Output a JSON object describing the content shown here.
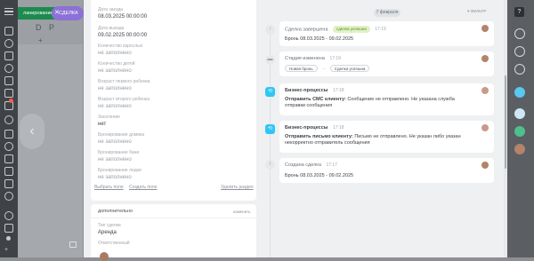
{
  "background_app": {
    "green_bar_label": "ланирование (1",
    "deal_chip_label": "СДЕЛКА",
    "close_glyph": "✕",
    "list_header": "D P",
    "plus_glyph": "+",
    "arrow_glyph": "‹"
  },
  "details": {
    "fields": [
      {
        "label": "Дата заезда",
        "value": "08.03.2025 00:00:00"
      },
      {
        "label": "Дата выезда",
        "value": "09.02.2025 00:00:00"
      },
      {
        "label": "Количество взрослых",
        "value": "не заполнено"
      },
      {
        "label": "Количество детей",
        "value": "не заполнено"
      },
      {
        "label": "Возраст первого ребенка",
        "value": "не заполнено"
      },
      {
        "label": "Возраст второго ребенка",
        "value": "не заполнено"
      },
      {
        "label": "Заселение",
        "value": "нет"
      },
      {
        "label": "Бронирование домика",
        "value": "не заполнено"
      },
      {
        "label": "Бронирование бани",
        "value": "не заполнено"
      },
      {
        "label": "Бронирование лодки",
        "value": "не заполнено"
      }
    ],
    "select_field": "Выбрать поле",
    "create_field": "Создать поле",
    "delete_section": "Удалить раздел"
  },
  "additional": {
    "title": "дополнительно",
    "change": "изменить",
    "deal_type_label": "Тип сделки",
    "deal_type_value": "Аренда",
    "responsible_label": "Ответственный"
  },
  "timeline": {
    "date_pill": "7 февраля",
    "filter_label": "ФИЛЬТР",
    "events": [
      {
        "title": "Сделка завершена",
        "badge": "сделка успешна",
        "time": "17:19",
        "body": "Бронь 08.03.2025 - 09.02.2025"
      },
      {
        "title": "Стадия изменена",
        "time": "17:19",
        "from_stage": "Новая бронь",
        "arrow": "→",
        "to_stage": "Сделка успешна"
      },
      {
        "title": "Бизнес-процессы",
        "time": "17:18",
        "body_bold": "Отправить СМС клиенту:",
        "body": " Сообщение не отправлено. Не указана служба отправки сообщения"
      },
      {
        "title": "Бизнес-процессы",
        "time": "17:18",
        "body_bold": "Отправить письмо клиенту:",
        "body": " Письмо не отправлено. Не указан либо указан некорректно отправитель сообщения"
      },
      {
        "title": "Создана сделка",
        "time": "17:17",
        "body": "Бронь 08.03.2025 - 09.02.2025"
      }
    ]
  },
  "right_nav": {
    "help_glyph": "?"
  },
  "colors": {
    "accent_purple": "#8c71d6",
    "green_bar": "#1d8a4f",
    "timeline_blue": "#2fc6f6",
    "success_badge_bg": "#dff2c6"
  }
}
